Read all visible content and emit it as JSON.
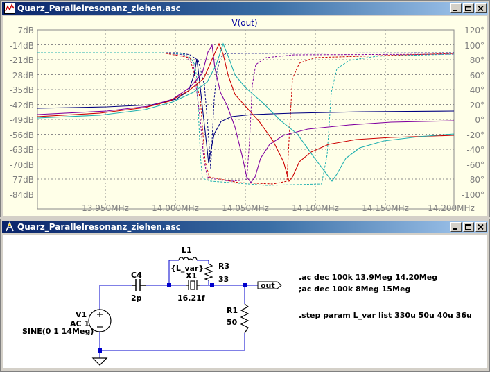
{
  "windows": {
    "plot": {
      "title": "Quarz_Parallelresonanz_ziehen.asc",
      "trace_label": "V(out)",
      "left_axis_ticks": [
        "-7dB",
        "-14dB",
        "-21dB",
        "-28dB",
        "-35dB",
        "-42dB",
        "-49dB",
        "-56dB",
        "-63dB",
        "-70dB",
        "-77dB",
        "-84dB"
      ],
      "right_axis_ticks": [
        "120°",
        "100°",
        "80°",
        "60°",
        "40°",
        "20°",
        "0°",
        "-20°",
        "-40°",
        "-60°",
        "-80°",
        "-100°"
      ],
      "x_axis_ticks": [
        "13.950MHz",
        "14.000MHz",
        "14.050MHz",
        "14.100MHz",
        "14.150MHz",
        "14.200MHz"
      ]
    },
    "schematic": {
      "title": "Quarz_Parallelresonanz_ziehen.asc",
      "components": {
        "l1_name": "L1",
        "l1_value": "{L_var}",
        "r3_name": "R3",
        "r3_value": "33",
        "c4_name": "C4",
        "c4_value": "2p",
        "x1_name": "X1",
        "x1_value": "16.21f",
        "r1_name": "R1",
        "r1_value": "50",
        "v1_name": "V1",
        "v1_ac": "AC 1",
        "v1_value": "SINE(0 1 14Meg)",
        "out_label": "out"
      },
      "directives": [
        ".ac dec 100k 13.9Meg 14.20Meg",
        ";ac dec 100k 8Meg 15Meg",
        ".step param L_var list 330u 50u 40u 36u"
      ]
    }
  },
  "colors": {
    "trace_navy": "#000080",
    "trace_purple": "#8000a0",
    "trace_red": "#cc0000",
    "trace_teal": "#20b0b0",
    "wire": "#0000cc",
    "title_label": "#0000a0"
  },
  "icons": [
    "plot-window-icon",
    "schematic-window-icon",
    "minimize-icon",
    "restore-icon",
    "close-icon",
    "ground-icon",
    "voltage-source-icon",
    "inductor-icon",
    "resistor-icon",
    "capacitor-icon",
    "crystal-icon",
    "output-port-icon"
  ]
}
